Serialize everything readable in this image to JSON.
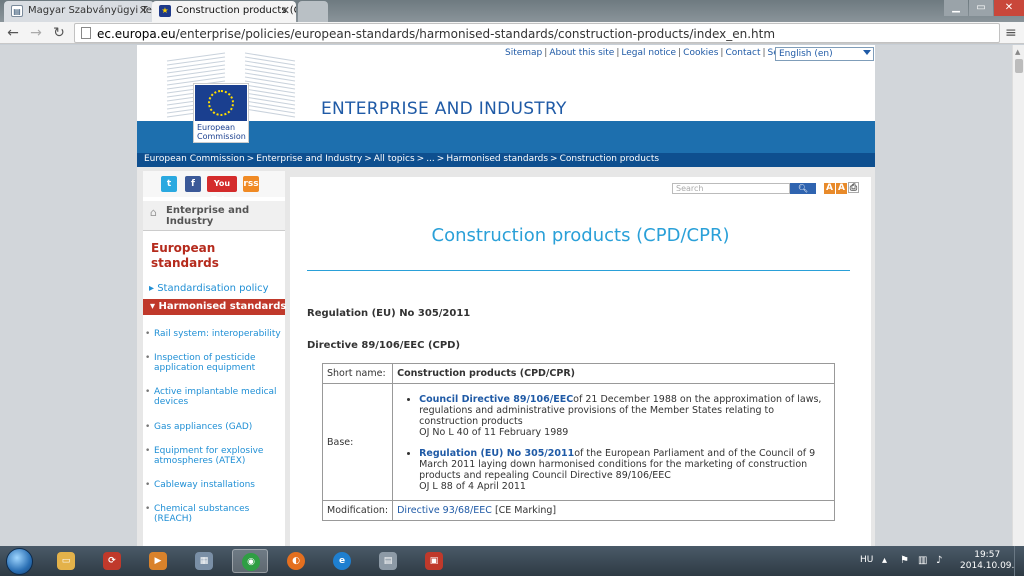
{
  "browser": {
    "tabs": [
      {
        "title": "Magyar Szabványügyi Te",
        "active": false
      },
      {
        "title": "Construction products (C",
        "active": true
      }
    ],
    "url_domain": "ec.europa.eu",
    "url_path": "/enterprise/policies/european-standards/harmonised-standards/construction-products/index_en.htm"
  },
  "site": {
    "top_links": [
      "Sitemap",
      "About this site",
      "Legal notice",
      "Cookies",
      "Contact",
      "Search"
    ],
    "language": "English (en)",
    "logo_text_line1": "European",
    "logo_text_line2": "Commission",
    "name": "ENTERPRISE AND INDUSTRY",
    "breadcrumb": [
      "European Commission",
      "Enterprise and Industry",
      "All topics",
      "...",
      "Harmonised standards",
      "Construction products"
    ]
  },
  "sidebar": {
    "social": [
      "t",
      "f",
      "You Tube",
      "rss"
    ],
    "home_line1": "Enterprise and",
    "home_line2": "Industry",
    "section_line1": "European",
    "section_line2": "standards",
    "link": "Standardisation policy",
    "active": "Harmonised standards",
    "subitems": [
      {
        "line1": "Rail system: interoperability",
        "line2": ""
      },
      {
        "line1": "Inspection of pesticide",
        "line2": "application equipment"
      },
      {
        "line1": "Active implantable medical",
        "line2": "devices"
      },
      {
        "line1": "Gas appliances (GAD)",
        "line2": ""
      },
      {
        "line1": "Equipment for explosive",
        "line2": "atmospheres (ATEX)"
      },
      {
        "line1": "Cableway installations",
        "line2": ""
      },
      {
        "line1": "Chemical substances",
        "line2": "(REACH)"
      }
    ]
  },
  "main": {
    "search_placeholder": "Search",
    "title": "Construction products (CPD/CPR)",
    "heading1": "Regulation (EU) No 305/2011",
    "heading2": "Directive 89/106/EEC (CPD)",
    "table": {
      "short_name_label": "Short name:",
      "short_name_value": "Construction products (CPD/CPR)",
      "base_label": "Base:",
      "base1_link": "Council Directive 89/106/EEC",
      "base1_text": "of 21 December 1988 on the approximation of laws, regulations and administrative provisions of the Member States relating to construction products",
      "base1_oj": "OJ No L 40 of 11 February 1989",
      "base2_link": "Regulation (EU) No 305/2011",
      "base2_text": "of the European Parliament and of the Council of 9 March 2011 laying down harmonised conditions for the marketing of construction products and repealing Council Directive 89/106/EEC",
      "base2_oj": "OJ L 88 of 4 April 2011",
      "modification_label": "Modification:",
      "modification_link": "Directive 93/68/EEC",
      "modification_text": "[CE Marking]"
    }
  },
  "taskbar": {
    "lang": "HU",
    "time": "19:57",
    "date": "2014.10.09."
  }
}
